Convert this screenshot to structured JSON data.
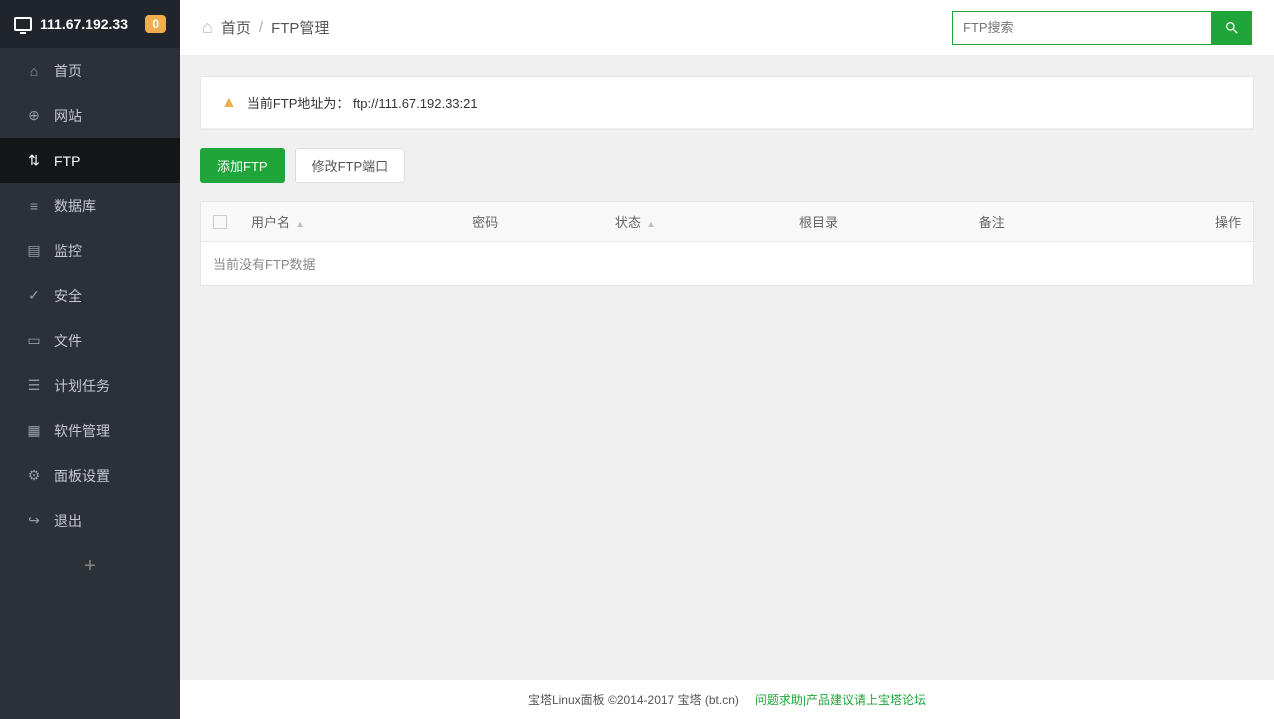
{
  "header": {
    "ip": "111.67.192.33",
    "badge": "0"
  },
  "sidebar": {
    "items": [
      {
        "label": "首页",
        "icon": "⌂"
      },
      {
        "label": "网站",
        "icon": "⊕"
      },
      {
        "label": "FTP",
        "icon": "⇅",
        "active": true
      },
      {
        "label": "数据库",
        "icon": "≡"
      },
      {
        "label": "监控",
        "icon": "▤"
      },
      {
        "label": "安全",
        "icon": "✓"
      },
      {
        "label": "文件",
        "icon": "▭"
      },
      {
        "label": "计划任务",
        "icon": "☰"
      },
      {
        "label": "软件管理",
        "icon": "▦"
      },
      {
        "label": "面板设置",
        "icon": "⚙"
      },
      {
        "label": "退出",
        "icon": "↪"
      }
    ],
    "plus": "+"
  },
  "breadcrumb": {
    "home": "首页",
    "current": "FTP管理"
  },
  "search": {
    "placeholder": "FTP搜索"
  },
  "alert": {
    "prefix": "当前FTP地址为：",
    "url": "ftp://111.67.192.33:21"
  },
  "buttons": {
    "add": "添加FTP",
    "modify": "修改FTP端口"
  },
  "table": {
    "cols": {
      "user": "用户名",
      "pass": "密码",
      "status": "状态",
      "root": "根目录",
      "note": "备注",
      "action": "操作"
    },
    "empty": "当前没有FTP数据"
  },
  "footer": {
    "copyright": "宝塔Linux面板 ©2014-2017 宝塔 (bt.cn)",
    "link": "问题求助|产品建议请上宝塔论坛"
  }
}
